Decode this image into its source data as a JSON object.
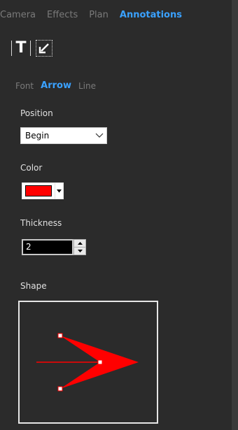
{
  "tabs": [
    {
      "label": "Camera",
      "active": false
    },
    {
      "label": "Effects",
      "active": false
    },
    {
      "label": "Plan",
      "active": false
    },
    {
      "label": "Annotations",
      "active": true
    }
  ],
  "tools": {
    "text_tool_label": "T",
    "arrow_tool_icon": "arrow-tool-icon"
  },
  "subtabs": [
    {
      "label": "Font",
      "active": false
    },
    {
      "label": "Arrow",
      "active": true
    },
    {
      "label": "Line",
      "active": false
    }
  ],
  "position": {
    "label": "Position",
    "selected": "Begin"
  },
  "color": {
    "label": "Color",
    "value": "#ff0000"
  },
  "thickness": {
    "label": "Thickness",
    "value": "2"
  },
  "shape": {
    "label": "Shape"
  },
  "colors": {
    "accent": "#3aa1ff",
    "background": "#2b2b2b",
    "arrow_fill": "#ff0000"
  }
}
